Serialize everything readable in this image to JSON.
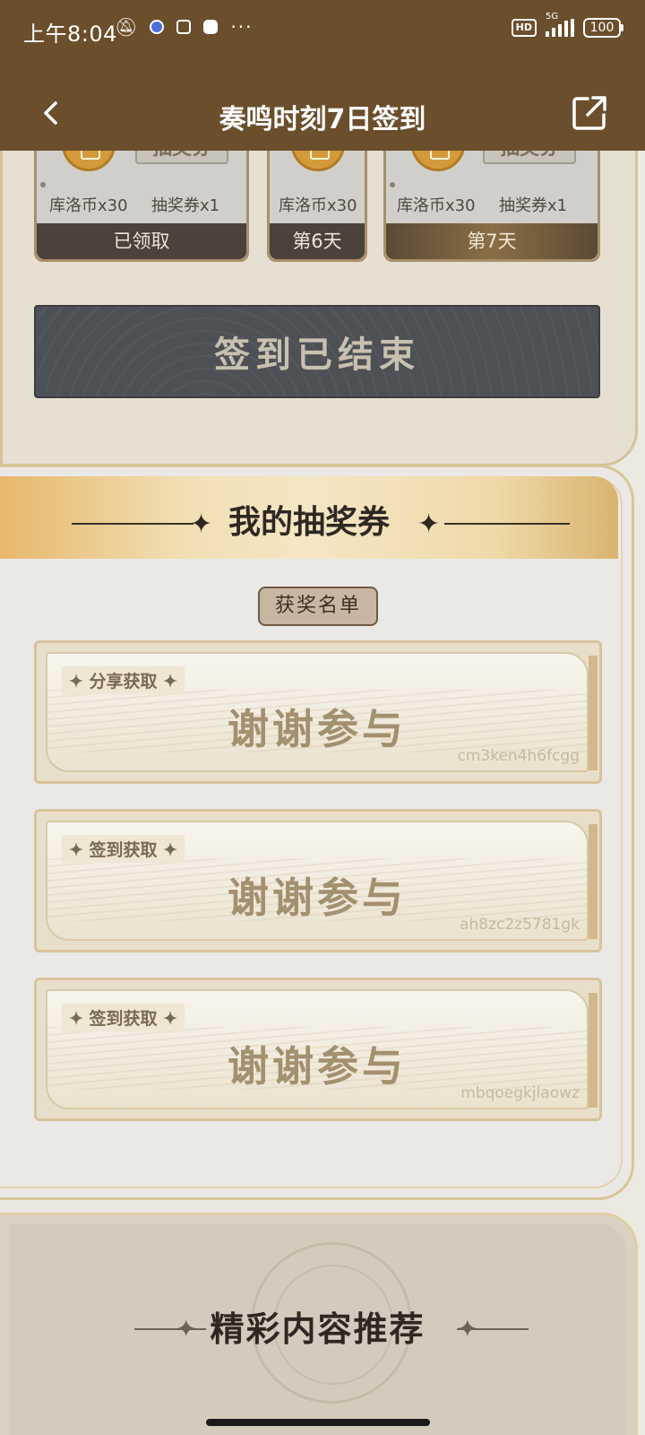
{
  "status_bar": {
    "time": "上午8:04",
    "more": "···",
    "hd": "HD",
    "network": "5G",
    "battery": "100"
  },
  "title_bar": {
    "title": "奏鸣时刻7日签到"
  },
  "day_cards": [
    {
      "reward1": "库洛币x30",
      "reward2": "抽奖券x1",
      "ticket_img": "抽奖券",
      "label": "已领取"
    },
    {
      "reward1": "库洛币x30",
      "label": "第6天"
    },
    {
      "reward1": "库洛币x30",
      "reward2": "抽奖券x1",
      "ticket_img": "抽奖券",
      "label": "第7天"
    }
  ],
  "signin": {
    "ended_label": "签到已结束"
  },
  "lottery": {
    "title": "我的抽奖券",
    "winners_label": "获奖名单",
    "tickets": [
      {
        "source": "✦ 分享获取 ✦",
        "prize": "谢谢参与",
        "code": "cm3ken4h6fcgg"
      },
      {
        "source": "✦ 签到获取 ✦",
        "prize": "谢谢参与",
        "code": "ah8zc2z5781gk"
      },
      {
        "source": "✦ 签到获取 ✦",
        "prize": "谢谢参与",
        "code": "mbqoegkjlaowz"
      }
    ]
  },
  "recommend": {
    "title": "精彩内容推荐"
  },
  "colors": {
    "header_bg": "#6b4f2c",
    "ended_button_bg": "#4d5055",
    "ticket_gold": "#d7c39d"
  }
}
